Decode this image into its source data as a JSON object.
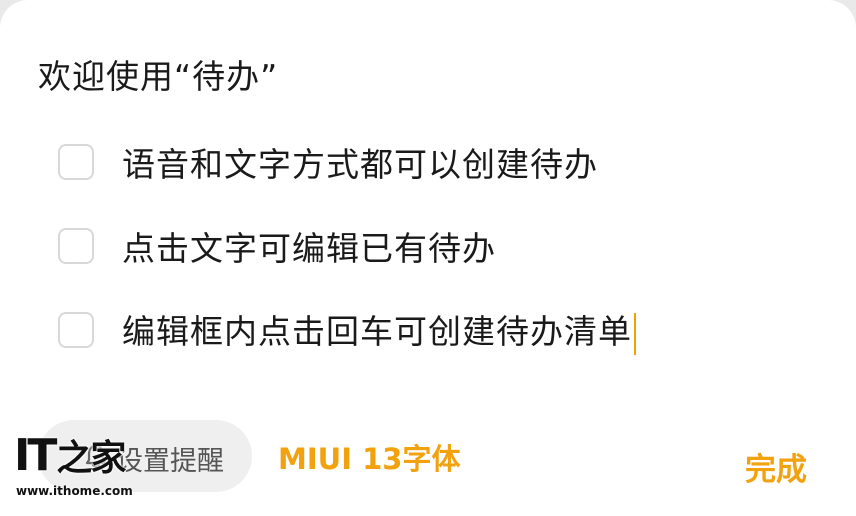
{
  "dialog": {
    "title": "欢迎使用“待办”"
  },
  "todos": [
    {
      "text": "语音和文字方式都可以创建待办",
      "checked": false
    },
    {
      "text": "点击文字可编辑已有待办",
      "checked": false
    },
    {
      "text": "编辑框内点击回车可创建待办清单",
      "checked": false
    }
  ],
  "footer": {
    "reminder_label": "设置提醒",
    "reminder_icon": "bell-icon",
    "font_note": "MIUI 13字体",
    "done_label": "完成"
  },
  "watermark": {
    "logo": "IT之家",
    "url": "www.ithome.com"
  },
  "colors": {
    "accent": "#f2a20e",
    "caret": "#f5a000",
    "pill": "#efefef",
    "checkbox_border": "#d8d8d8"
  }
}
